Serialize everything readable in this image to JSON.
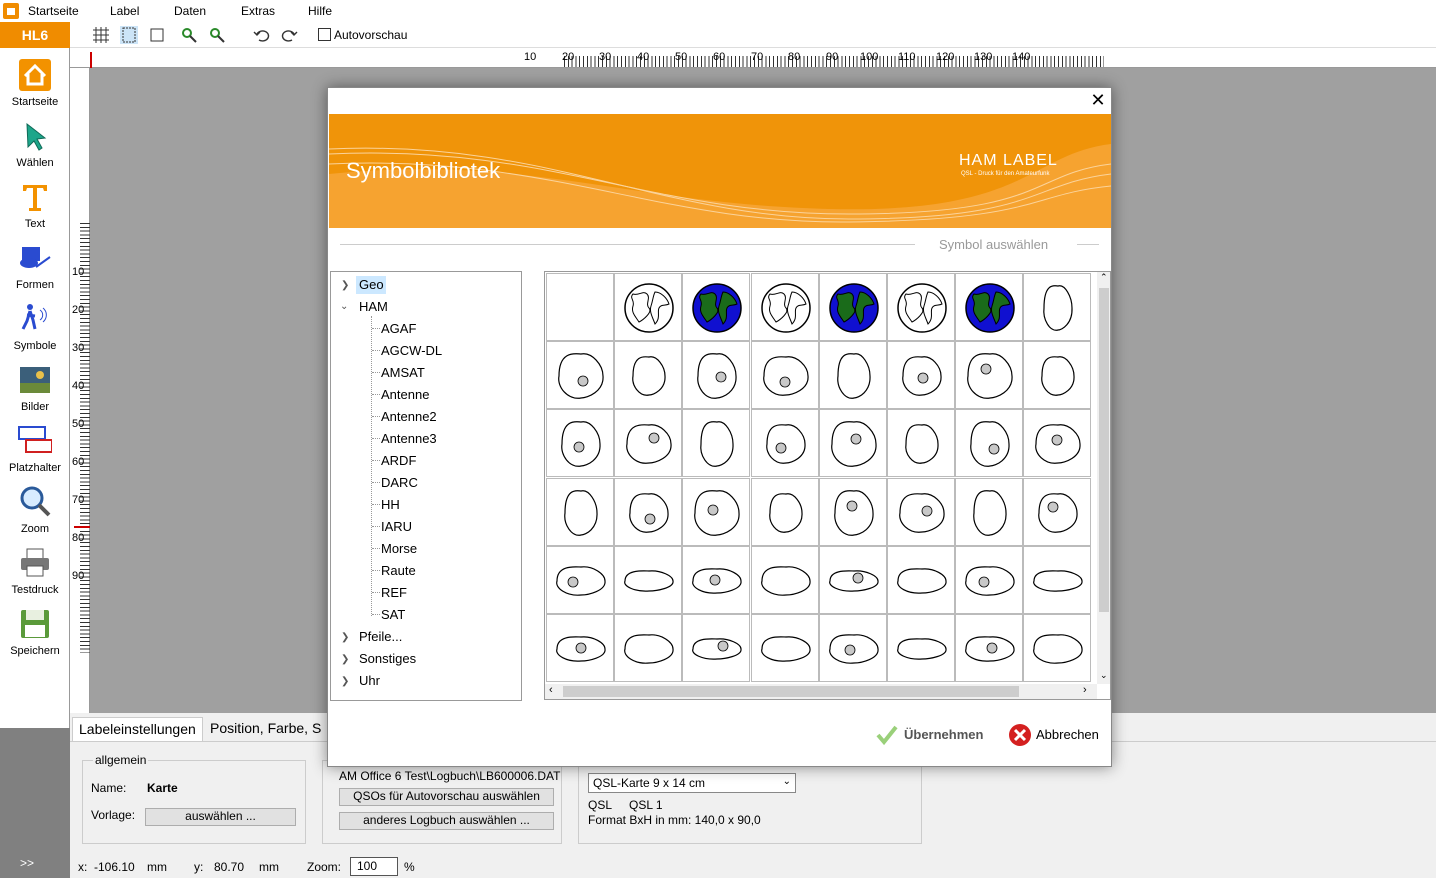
{
  "app": {
    "badge": "HL6"
  },
  "menu": {
    "items": [
      "Startseite",
      "Label",
      "Daten",
      "Extras",
      "Hilfe"
    ]
  },
  "toolbar": {
    "autopreview_label": "Autovorschau"
  },
  "sidebar": {
    "items": [
      {
        "label": "Startseite",
        "icon": "home-icon"
      },
      {
        "label": "Wählen",
        "icon": "cursor-icon"
      },
      {
        "label": "Text",
        "icon": "text-icon"
      },
      {
        "label": "Formen",
        "icon": "shapes-icon"
      },
      {
        "label": "Symbole",
        "icon": "symbols-icon"
      },
      {
        "label": "Bilder",
        "icon": "image-icon"
      },
      {
        "label": "Platzhalter",
        "icon": "placeholder-icon"
      },
      {
        "label": "Zoom",
        "icon": "zoom-icon"
      },
      {
        "label": "Testdruck",
        "icon": "printer-icon"
      },
      {
        "label": "Speichern",
        "icon": "save-icon"
      }
    ],
    "expand": ">>"
  },
  "ruler": {
    "h_labels": [
      "10",
      "20",
      "30",
      "40",
      "50",
      "60",
      "70",
      "80",
      "90",
      "100",
      "110",
      "120",
      "130",
      "140"
    ],
    "v_labels": [
      "10",
      "20",
      "30",
      "40",
      "50",
      "60",
      "70",
      "80",
      "90"
    ]
  },
  "bottom": {
    "tabs": [
      "Labeleinstellungen",
      "Position, Farbe, S"
    ],
    "general": {
      "legend": "allgemein",
      "name_label": "Name:",
      "name_value": "Karte",
      "template_label": "Vorlage:",
      "select_button": "auswählen ..."
    },
    "logbook": {
      "path": "AM Office 6 Test\\Logbuch\\LB600006.DAT",
      "qso_button": "QSOs für Autovorschau auswählen",
      "other_button": "anderes Logbuch auswählen ..."
    },
    "format": {
      "selected": "QSL-Karte 9 x 14 cm",
      "type": "QSL",
      "name": "QSL 1",
      "size_text": "Format BxH in mm: 140,0 x 90,0"
    }
  },
  "status": {
    "x_label": "x:",
    "x_value": "-106.10",
    "x_unit": "mm",
    "y_label": "y:",
    "y_value": "80.70",
    "y_unit": "mm",
    "zoom_label": "Zoom:",
    "zoom_value": "100",
    "zoom_unit": "%"
  },
  "dialog": {
    "title": "Symbolbibliotek",
    "brand": "HAM LABEL",
    "brand_sub": "QSL - Druck für den Amateurfunk",
    "subtitle": "Symbol auswählen",
    "tree": [
      {
        "label": "Geo",
        "level": 0,
        "state": "collapsed",
        "selected": true
      },
      {
        "label": "HAM",
        "level": 0,
        "state": "expanded"
      },
      {
        "label": "AGAF",
        "level": 1
      },
      {
        "label": "AGCW-DL",
        "level": 1
      },
      {
        "label": "AMSAT",
        "level": 1
      },
      {
        "label": "Antenne",
        "level": 1
      },
      {
        "label": "Antenne2",
        "level": 1
      },
      {
        "label": "Antenne3",
        "level": 1
      },
      {
        "label": "ARDF",
        "level": 1
      },
      {
        "label": "DARC",
        "level": 1
      },
      {
        "label": "HH",
        "level": 1
      },
      {
        "label": "IARU",
        "level": 1
      },
      {
        "label": "Morse",
        "level": 1
      },
      {
        "label": "Raute",
        "level": 1
      },
      {
        "label": "REF",
        "level": 1
      },
      {
        "label": "SAT",
        "level": 1
      },
      {
        "label": "Pfeile...",
        "level": 0,
        "state": "collapsed"
      },
      {
        "label": "Sonstiges",
        "level": 0,
        "state": "collapsed"
      },
      {
        "label": "Uhr",
        "level": 0,
        "state": "collapsed"
      }
    ],
    "ok_label": "Übernehmen",
    "cancel_label": "Abbrechen",
    "colors": {
      "banner": "#f09409",
      "globe_ocean": "#1010d0",
      "globe_land": "#1a6b1a",
      "highlight": "#c8c8c8"
    }
  }
}
